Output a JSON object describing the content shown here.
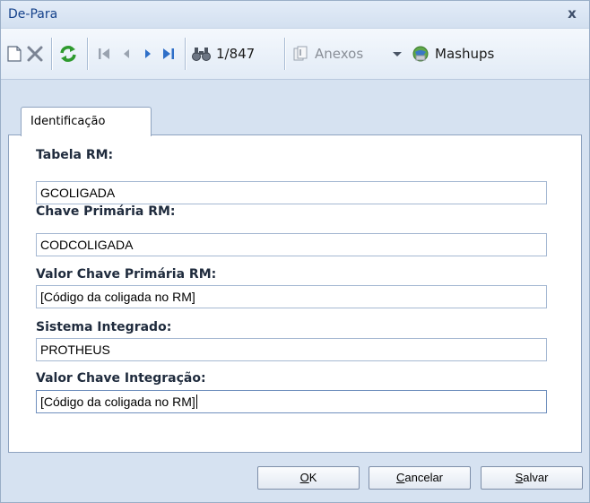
{
  "window": {
    "title": "De-Para",
    "close_symbol": "x"
  },
  "toolbar": {
    "record_position": "1/847",
    "anexos_label": "Anexos",
    "mashups_label": "Mashups",
    "icons": [
      "new-icon",
      "delete-icon",
      "refresh-icon",
      "first-record-icon",
      "previous-record-icon",
      "next-record-icon",
      "last-record-icon",
      "find-icon",
      "attachment-icon",
      "dropdown-arrow-icon",
      "mashups-icon"
    ]
  },
  "tabs": [
    {
      "label": "Identificação",
      "active": true
    }
  ],
  "form": {
    "fields": [
      {
        "label": "Tabela RM:",
        "value": "GCOLIGADA"
      },
      {
        "label": "Chave Primária RM:",
        "value": "CODCOLIGADA"
      },
      {
        "label": "Valor Chave Primária RM:",
        "value": "[Código da coligada no RM]"
      },
      {
        "label": "Sistema Integrado:",
        "value": "PROTHEUS"
      },
      {
        "label": "Valor Chave Integração:",
        "value": "[Código da coligada no RM]"
      }
    ]
  },
  "buttons": {
    "ok": {
      "accel": "O",
      "rest": "K"
    },
    "cancel": {
      "accel": "C",
      "rest": "ancelar"
    },
    "save": {
      "accel": "S",
      "rest": "alvar"
    }
  },
  "colors": {
    "title_text": "#15428b",
    "frame_background": "#d6e2f1",
    "refresh_green": "#2e9a2e",
    "nav_blue": "#2f6fc8"
  }
}
